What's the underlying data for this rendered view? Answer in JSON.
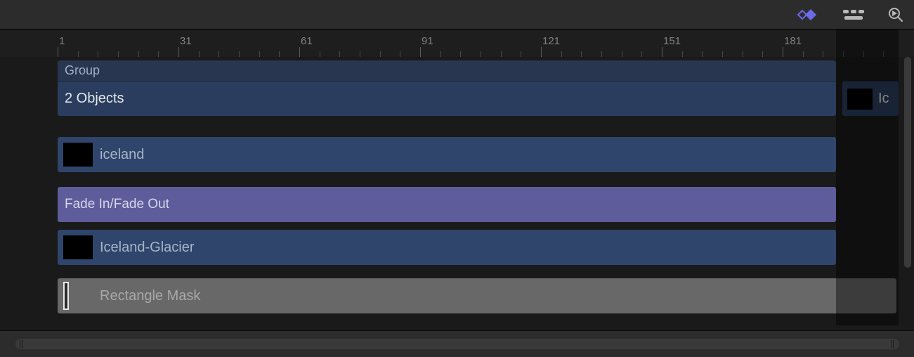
{
  "colors": {
    "accent_keyframe": "#6b6ae8",
    "clip_blue": "#2f456b",
    "clip_purple": "#5e5c9a",
    "clip_gray": "#686868"
  },
  "ruler": {
    "start": 1,
    "step": 30,
    "count": 7,
    "labels": [
      "1",
      "31",
      "61",
      "91",
      "121",
      "151",
      "181"
    ],
    "minor_per_major": 6
  },
  "group": {
    "title": "Group",
    "summary": "2 Objects",
    "overflow_label": "Ic"
  },
  "clips": {
    "iceland": {
      "label": "iceland"
    },
    "fade": {
      "label": "Fade In/Fade Out"
    },
    "glacier": {
      "label": "Iceland-Glacier"
    },
    "mask": {
      "label": "Rectangle Mask"
    }
  }
}
